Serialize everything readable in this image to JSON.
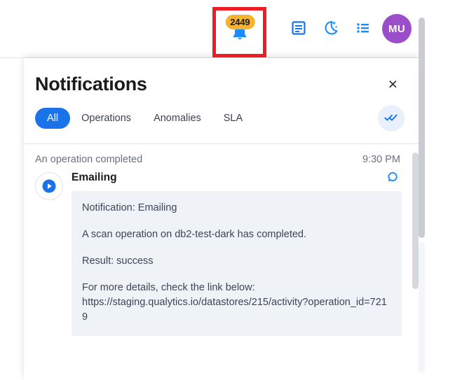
{
  "header": {
    "bell": {
      "icon": "bell-icon",
      "badge_count": "2449",
      "badge_color": "#f6b333",
      "icon_color": "#1a8cff",
      "highlight_color": "#ee1c25"
    },
    "actions": [
      {
        "icon": "document-icon",
        "color": "#1a73e8"
      },
      {
        "icon": "moon-stars-icon",
        "color": "#1a73e8"
      },
      {
        "icon": "bulleted-list-icon",
        "color": "#1a73e8"
      }
    ],
    "avatar": {
      "initials": "MU",
      "color": "#9b4dca"
    }
  },
  "panel": {
    "title": "Notifications",
    "close_label": "×",
    "tabs": [
      {
        "label": "All",
        "active": true
      },
      {
        "label": "Operations",
        "active": false
      },
      {
        "label": "Anomalies",
        "active": false
      },
      {
        "label": "SLA",
        "active": false
      }
    ],
    "mark_all_read_icon": "double-check-icon",
    "accent_color": "#1a73e8"
  },
  "notifications": [
    {
      "category": "An operation completed",
      "time": "9:30 PM",
      "status_icon": "play-circle-icon",
      "title": "Emailing",
      "search_icon": "search-icon",
      "message": {
        "line1": "Notification: Emailing",
        "line2": "A scan operation on db2-test-dark has completed.",
        "line3": "Result: success",
        "line4": "For more details, check the link below:",
        "link": "https://staging.qualytics.io/datastores/215/activity?operation_id=7219"
      }
    }
  ]
}
